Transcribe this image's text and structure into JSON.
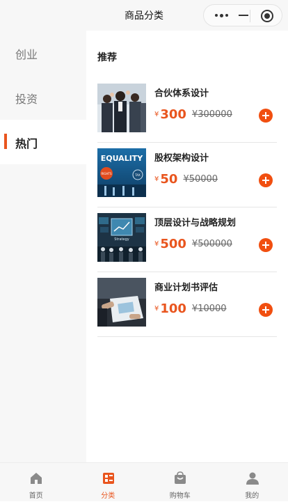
{
  "header": {
    "title": "商品分类"
  },
  "sidebar": {
    "items": [
      {
        "label": "创业",
        "active": false
      },
      {
        "label": "投资",
        "active": false
      },
      {
        "label": "热门",
        "active": true
      }
    ]
  },
  "content": {
    "section_title": "推荐",
    "currency": "¥",
    "products": [
      {
        "name": "合伙体系设计",
        "price": "300",
        "original_price": "¥300000"
      },
      {
        "name": "股权架构设计",
        "price": "50",
        "original_price": "¥50000",
        "thumb_text": [
          "EQUALITY",
          "RIGHTS",
          "TAX"
        ]
      },
      {
        "name": "顶层设计与战略规划",
        "price": "500",
        "original_price": "¥500000",
        "thumb_text": [
          "Strategy"
        ]
      },
      {
        "name": "商业计划书评估",
        "price": "100",
        "original_price": "¥10000"
      }
    ]
  },
  "tabbar": {
    "items": [
      {
        "label": "首页",
        "icon": "home-icon",
        "active": false
      },
      {
        "label": "分类",
        "icon": "category-icon",
        "active": true
      },
      {
        "label": "购物车",
        "icon": "cart-icon",
        "active": false
      },
      {
        "label": "我的",
        "icon": "user-icon",
        "active": false
      }
    ]
  },
  "colors": {
    "accent": "#e9551e",
    "add_button": "#f14f10",
    "inactive": "#8a8a8a"
  }
}
